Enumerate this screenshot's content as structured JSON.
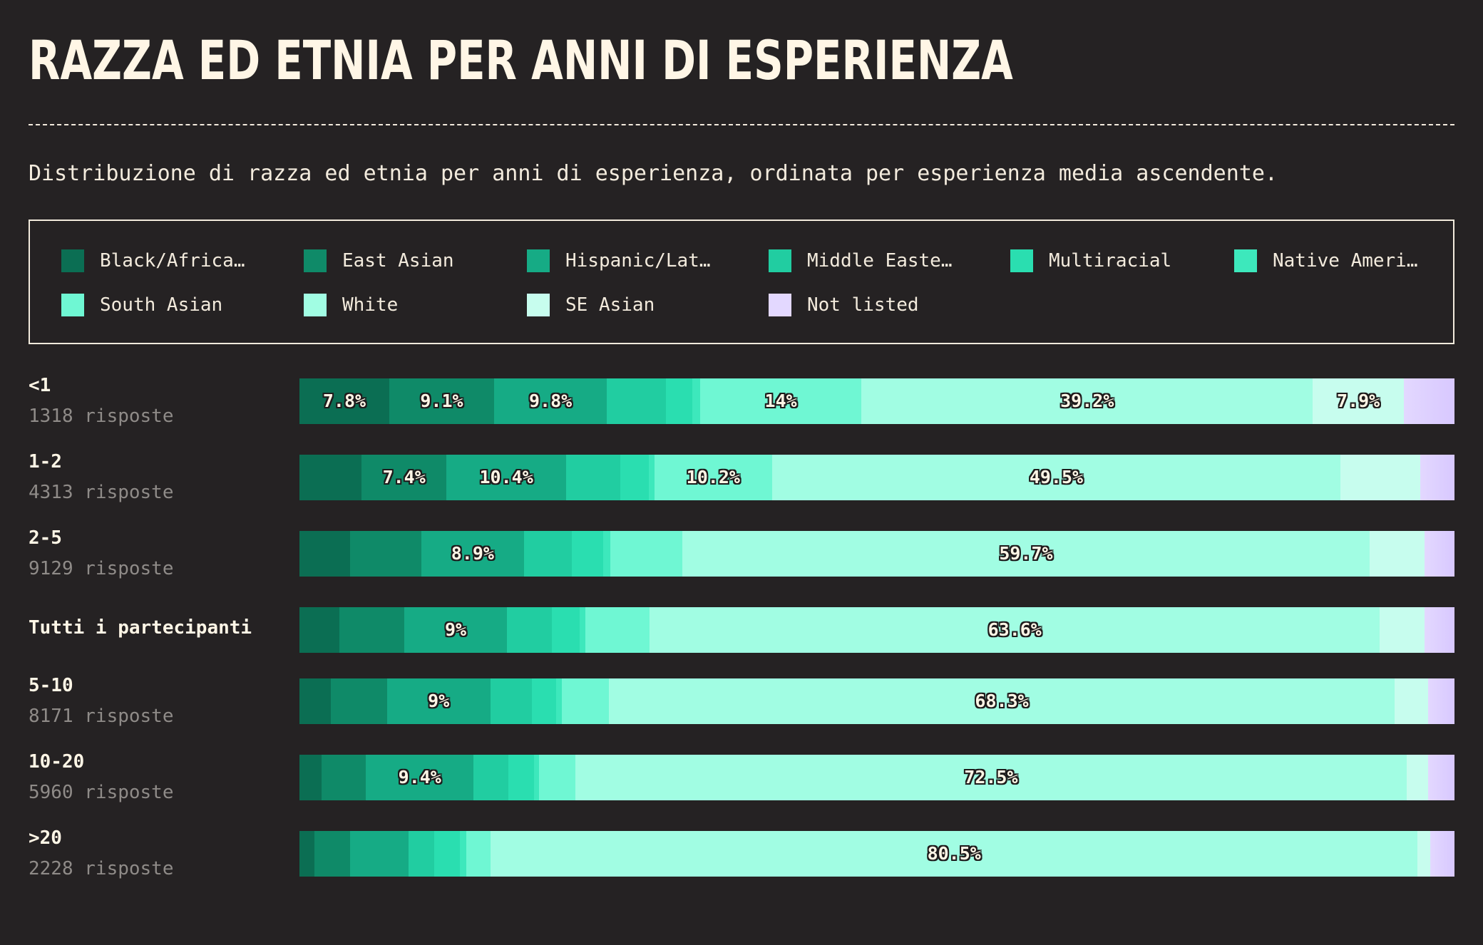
{
  "header": {
    "title": "RAZZA ED ETNIA PER ANNI DI ESPERIENZA",
    "subtitle": "Distribuzione di razza ed etnia per anni di esperienza, ordinata per esperienza media ascendente."
  },
  "legend": [
    {
      "label": "Black/Africa…",
      "color": "#0b6e53"
    },
    {
      "label": "East Asian",
      "color": "#0f8a68"
    },
    {
      "label": "Hispanic/Lat…",
      "color": "#16ab85"
    },
    {
      "label": "Middle Easte…",
      "color": "#21cda1"
    },
    {
      "label": "Multiracial",
      "color": "#2adeb0"
    },
    {
      "label": "Native Ameri…",
      "color": "#3de8bc"
    },
    {
      "label": "South Asian",
      "color": "#6ff7d3"
    },
    {
      "label": "White",
      "color": "#a1fde3"
    },
    {
      "label": "SE Asian",
      "color": "#c7fdee"
    },
    {
      "label": "Not listed",
      "color": "#e3d8ff"
    }
  ],
  "chart_data": {
    "type": "bar",
    "orientation": "horizontal",
    "stacked": true,
    "title": "RAZZA ED ETNIA PER ANNI DI ESPERIENZA",
    "xlim": [
      0,
      100
    ],
    "categories": [
      "<1",
      "1-2",
      "2-5",
      "Tutti i partecipanti",
      "5-10",
      "10-20",
      ">20"
    ],
    "counts": [
      "1318 risposte",
      "4313 risposte",
      "9129 risposte",
      "",
      "8171 risposte",
      "5960 risposte",
      "2228 risposte"
    ],
    "series": [
      {
        "name": "Black/Africa…",
        "values": [
          7.8,
          5.4,
          4.4,
          3.5,
          2.7,
          1.9,
          1.3
        ]
      },
      {
        "name": "East Asian",
        "values": [
          9.1,
          7.4,
          6.2,
          5.6,
          4.9,
          3.9,
          3.1
        ]
      },
      {
        "name": "Hispanic/Lat…",
        "values": [
          9.8,
          10.4,
          8.9,
          9.0,
          9.0,
          9.4,
          5.1
        ]
      },
      {
        "name": "Middle Easte…",
        "values": [
          5.1,
          4.7,
          4.2,
          3.9,
          3.6,
          3.0,
          2.2
        ]
      },
      {
        "name": "Multiracial",
        "values": [
          2.3,
          2.5,
          2.7,
          2.4,
          2.1,
          2.3,
          2.2
        ]
      },
      {
        "name": "Native Ameri…",
        "values": [
          0.7,
          0.5,
          0.6,
          0.5,
          0.5,
          0.4,
          0.6
        ]
      },
      {
        "name": "South Asian",
        "values": [
          14.0,
          10.2,
          6.3,
          5.6,
          4.1,
          3.2,
          2.1
        ]
      },
      {
        "name": "White",
        "values": [
          39.2,
          49.5,
          59.7,
          63.6,
          68.3,
          72.5,
          80.5
        ]
      },
      {
        "name": "SE Asian",
        "values": [
          7.9,
          6.9,
          4.8,
          3.9,
          2.9,
          1.9,
          1.1
        ]
      },
      {
        "name": "Not listed",
        "values": [
          4.4,
          3.0,
          2.6,
          2.6,
          2.3,
          2.3,
          2.1
        ]
      }
    ],
    "labeled_segments": [
      [
        "7.8%",
        "9.1%",
        "9.8%",
        null,
        null,
        null,
        "14%",
        "39.2%",
        "7.9%",
        null
      ],
      [
        null,
        "7.4%",
        "10.4%",
        null,
        null,
        null,
        "10.2%",
        "49.5%",
        null,
        null
      ],
      [
        null,
        null,
        "8.9%",
        null,
        null,
        null,
        null,
        "59.7%",
        null,
        null
      ],
      [
        null,
        null,
        "9%",
        null,
        null,
        null,
        null,
        "63.6%",
        null,
        null
      ],
      [
        null,
        null,
        "9%",
        null,
        null,
        null,
        null,
        "68.3%",
        null,
        null
      ],
      [
        null,
        null,
        "9.4%",
        null,
        null,
        null,
        null,
        "72.5%",
        null,
        null
      ],
      [
        null,
        null,
        null,
        null,
        null,
        null,
        null,
        "80.5%",
        null,
        null
      ]
    ]
  }
}
